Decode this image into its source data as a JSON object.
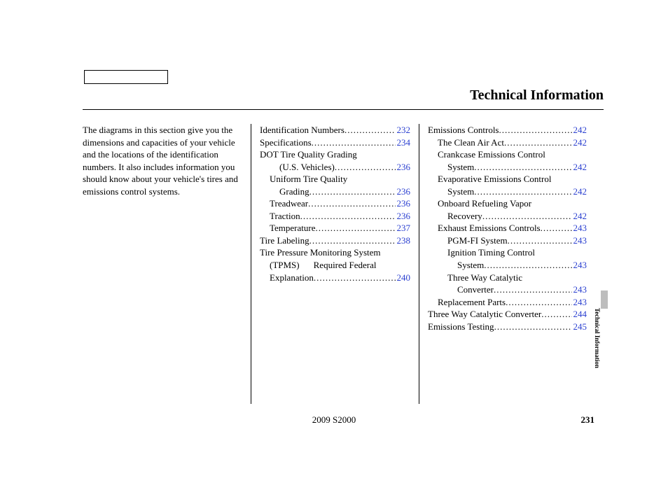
{
  "header": {
    "title": "Technical Information"
  },
  "intro": "The diagrams in this section give you the dimensions and capacities of your vehicle and the locations of the identification numbers. It also includes information you should know about your vehicle's tires and emissions control systems.",
  "col2": {
    "l1": {
      "label": "Identification Numbers",
      "page": "232"
    },
    "l2": {
      "label": "Specifications",
      "page": "234"
    },
    "l3": {
      "label": "DOT Tire Quality Grading"
    },
    "l3b": {
      "label": "(U.S. Vehicles)",
      "page": "236"
    },
    "l4": {
      "label": "Uniform Tire Quality"
    },
    "l4b": {
      "label": "Grading",
      "page": "236"
    },
    "l5": {
      "label": "Treadwear",
      "page": "236"
    },
    "l6": {
      "label": "Traction",
      "page": "236"
    },
    "l7": {
      "label": "Temperature",
      "page": "237"
    },
    "l8": {
      "label": "Tire Labeling",
      "page": "238"
    },
    "l9": {
      "label": "Tire Pressure Monitoring System"
    },
    "l9b": {
      "label": "(TPMS)",
      "mid": "Required Federal"
    },
    "l9c": {
      "label": "Explanation",
      "page": "240"
    }
  },
  "col3": {
    "m1": {
      "label": "Emissions Controls",
      "page": "242"
    },
    "m2": {
      "label": "The Clean Air Act",
      "page": "242"
    },
    "m3": {
      "label": "Crankcase Emissions Control"
    },
    "m3b": {
      "label": "System",
      "page": "242"
    },
    "m4": {
      "label": "Evaporative Emissions Control"
    },
    "m4b": {
      "label": "System",
      "page": "242"
    },
    "m5": {
      "label": "Onboard Refueling Vapor"
    },
    "m5b": {
      "label": "Recovery",
      "page": "242"
    },
    "m6": {
      "label": "Exhaust Emissions Controls",
      "page": "243"
    },
    "m7": {
      "label": "PGM-FI System",
      "page": "243"
    },
    "m8": {
      "label": "Ignition Timing Control"
    },
    "m8b": {
      "label": "System",
      "page": "243"
    },
    "m9": {
      "label": "Three Way Catalytic"
    },
    "m9b": {
      "label": "Converter",
      "page": "243"
    },
    "m10": {
      "label": "Replacement Parts",
      "page": "243"
    },
    "m11": {
      "label": "Three Way Catalytic Converter",
      "page": "244"
    },
    "m12": {
      "label": "Emissions Testing",
      "page": "245"
    }
  },
  "footer": {
    "model": "2009  S2000",
    "page": "231"
  },
  "sidetab": "Technical Information"
}
